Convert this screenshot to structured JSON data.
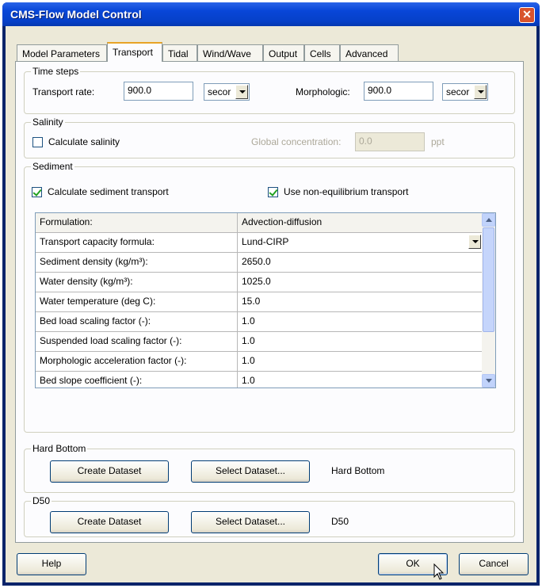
{
  "window": {
    "title": "CMS-Flow Model Control",
    "close_glyph": "✕"
  },
  "tabs": [
    "Model Parameters",
    "Transport",
    "Tidal",
    "Wind/Wave",
    "Output",
    "Cells",
    "Advanced"
  ],
  "active_tab": "Transport",
  "time_steps": {
    "label": "Time steps",
    "transport_rate_label": "Transport rate:",
    "transport_rate_value": "900.0",
    "transport_rate_unit": "secor",
    "morphologic_label": "Morphologic:",
    "morphologic_value": "900.0",
    "morphologic_unit": "secor"
  },
  "salinity": {
    "label": "Salinity",
    "calculate_label": "Calculate salinity",
    "calculate_checked": false,
    "global_concentration_label": "Global concentration:",
    "global_concentration_value": "0.0",
    "unit": "ppt"
  },
  "sediment": {
    "label": "Sediment",
    "calculate_label": "Calculate sediment transport",
    "calculate_checked": true,
    "nonequilibrium_label": "Use non-equilibrium transport",
    "nonequilibrium_checked": true,
    "grid": {
      "header": [
        "Formulation:",
        "Advection-diffusion"
      ],
      "rows": [
        [
          "Transport capacity formula:",
          "Lund-CIRP"
        ],
        [
          "Sediment density (kg/m³):",
          "2650.0"
        ],
        [
          "Water density (kg/m³):",
          "1025.0"
        ],
        [
          "Water temperature (deg C):",
          "15.0"
        ],
        [
          "Bed load scaling factor (-):",
          "1.0"
        ],
        [
          "Suspended load scaling factor (-):",
          "1.0"
        ],
        [
          "Morphologic acceleration factor (-):",
          "1.0"
        ],
        [
          "Bed slope coefficient (-):",
          "1.0"
        ]
      ]
    }
  },
  "hard_bottom": {
    "label": "Hard Bottom",
    "create_label": "Create Dataset",
    "select_label": "Select Dataset...",
    "dataset_name": "Hard Bottom"
  },
  "d50": {
    "label": "D50",
    "create_label": "Create Dataset",
    "select_label": "Select Dataset...",
    "dataset_name": "D50"
  },
  "footer": {
    "help_label": "Help",
    "ok_label": "OK",
    "cancel_label": "Cancel"
  },
  "colors": {
    "titlebar": "#0846d8",
    "dialog_bg": "#ece9d8",
    "page_bg": "#fcfcfe",
    "tab_highlight": "#e8a326"
  }
}
